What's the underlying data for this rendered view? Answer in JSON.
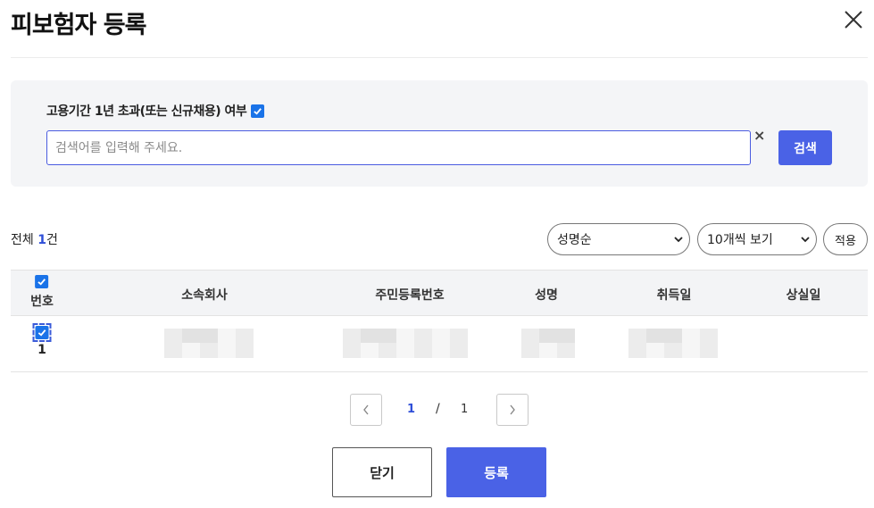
{
  "dialog": {
    "title": "피보험자 등록"
  },
  "search": {
    "filter_label": "고용기간 1년 초과(또는 신규채용) 여부",
    "filter_checked": true,
    "placeholder": "검색어를 입력해 주세요.",
    "value": "",
    "clear_label": "×",
    "search_label": "검색"
  },
  "list": {
    "total_prefix": "전체 ",
    "total_count": "1",
    "total_suffix": "건",
    "sort_selected": "성명순",
    "page_size_selected": "10개씩 보기",
    "apply_label": "적용"
  },
  "table": {
    "columns": [
      "번호",
      "소속회사",
      "주민등록번호",
      "성명",
      "취득일",
      "상실일"
    ],
    "header_checked": true,
    "rows": [
      {
        "checked": true,
        "no": "1"
      }
    ]
  },
  "pagination": {
    "current": "1",
    "separator": "/",
    "total": "1"
  },
  "footer": {
    "close_label": "닫기",
    "register_label": "등록"
  },
  "colors": {
    "accent": "#4a62e6",
    "count_text": "#2f4fd8",
    "checkbox": "#1a73e8"
  }
}
